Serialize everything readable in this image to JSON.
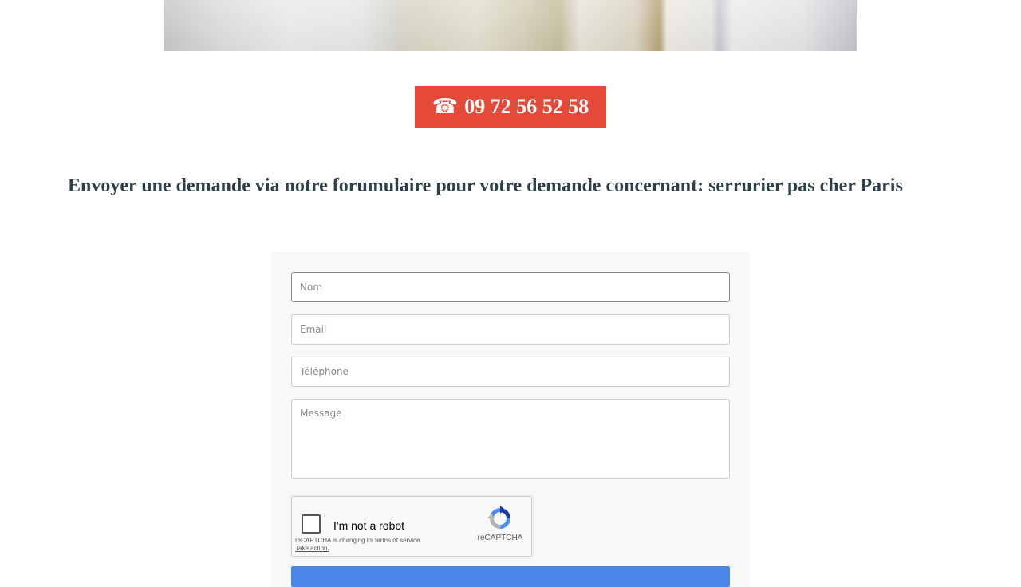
{
  "hero": {
    "icon": "door-photo"
  },
  "phone_button": {
    "icon": "telephone-icon",
    "icon_glyph": "☎",
    "number": "09 72 56 52 58",
    "color": "#e5493a"
  },
  "heading": {
    "text": "Envoyer une demande via notre forumulaire pour votre demande concernant: serrurier pas cher Paris"
  },
  "form": {
    "fields": {
      "nom": {
        "placeholder": "Nom",
        "value": ""
      },
      "email": {
        "placeholder": "Email",
        "value": ""
      },
      "telephone": {
        "placeholder": "Téléphone",
        "value": ""
      },
      "message": {
        "placeholder": "Message",
        "value": ""
      }
    },
    "recaptcha": {
      "label": "I'm not a robot",
      "brand": "reCAPTCHA",
      "notice": "reCAPTCHA is changing its terms of service.",
      "action": "Take action."
    },
    "submit_color": "#4a86e8"
  }
}
